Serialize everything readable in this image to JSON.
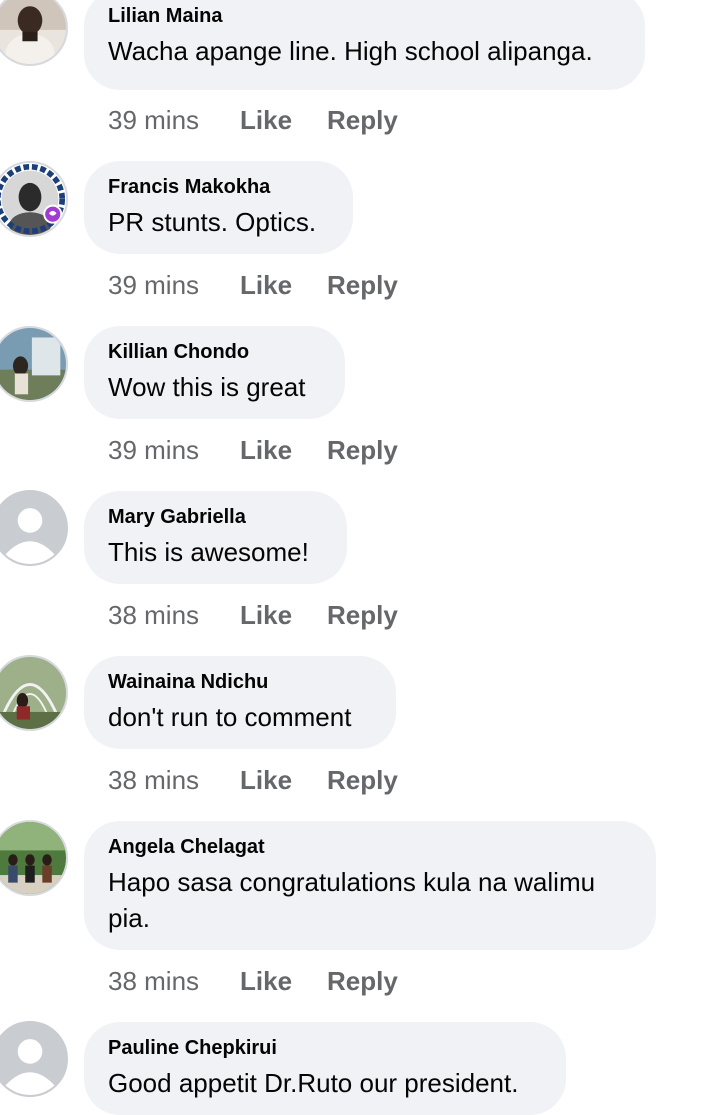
{
  "comments": [
    {
      "author": "Lilian Maina",
      "text": "Wacha apange line. High school alipanga.",
      "time": "39 mins",
      "like": "Like",
      "reply": "Reply",
      "avatar": "photo-icon"
    },
    {
      "author": "Francis Makokha",
      "text": "PR stunts. Optics.",
      "time": "39 mins",
      "like": "Like",
      "reply": "Reply",
      "avatar": "vaccine-frame-photo-icon",
      "avatar_ring_text": "I GOT MY COVID-19 VACCINE"
    },
    {
      "author": "Killian Chondo",
      "text": "Wow this is great",
      "time": "39 mins",
      "like": "Like",
      "reply": "Reply",
      "avatar": "photo-icon"
    },
    {
      "author": "Mary Gabriella",
      "text": "This is awesome!",
      "time": "38 mins",
      "like": "Like",
      "reply": "Reply",
      "avatar": "default-user-icon"
    },
    {
      "author": "Wainaina Ndichu",
      "text": "don't run to comment",
      "time": "38 mins",
      "like": "Like",
      "reply": "Reply",
      "avatar": "photo-icon"
    },
    {
      "author": "Angela Chelagat",
      "text": "Hapo sasa congratulations kula na walimu pia.",
      "time": "38 mins",
      "like": "Like",
      "reply": "Reply",
      "avatar": "photo-icon"
    },
    {
      "author": "Pauline Chepkirui",
      "text": "Good appetit Dr.Ruto our president.",
      "time": "",
      "like": "",
      "reply": "",
      "avatar": "default-user-icon"
    }
  ],
  "colors": {
    "bubble": "#f0f2f5",
    "author": "#050505",
    "meta": "#65676b",
    "default_avatar_bg": "#c9ccd1",
    "default_avatar_fg": "#ffffff",
    "vaccine_badge": "#a23bd1"
  }
}
